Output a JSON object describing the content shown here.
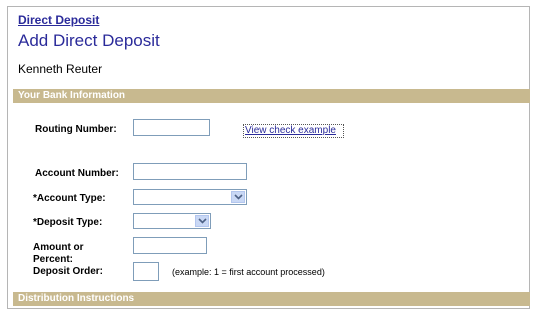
{
  "breadcrumb": {
    "label": "Direct Deposit"
  },
  "page": {
    "title": "Add Direct Deposit",
    "employee_name": "Kenneth Reuter"
  },
  "sections": {
    "bank_info": "Your Bank Information",
    "distribution": "Distribution Instructions"
  },
  "form": {
    "routing_number": {
      "label": "Routing Number:",
      "value": ""
    },
    "view_check_link": "View check example",
    "account_number": {
      "label": "Account Number:",
      "value": ""
    },
    "account_type": {
      "label": "*Account Type:",
      "value": ""
    },
    "deposit_type": {
      "label": "*Deposit Type:",
      "value": ""
    },
    "amount": {
      "label_line1": "Amount or",
      "label_line2": "Percent:",
      "value": ""
    },
    "deposit_order": {
      "label": "Deposit Order:",
      "value": "",
      "hint": "(example: 1 = first account processed)"
    }
  },
  "icons": {
    "dropdown": "chevron-down-icon"
  },
  "colors": {
    "section_bar": "#c8b98f",
    "link": "#2a2a9a",
    "title": "#2b2b9a",
    "input_border": "#7f9db9"
  }
}
